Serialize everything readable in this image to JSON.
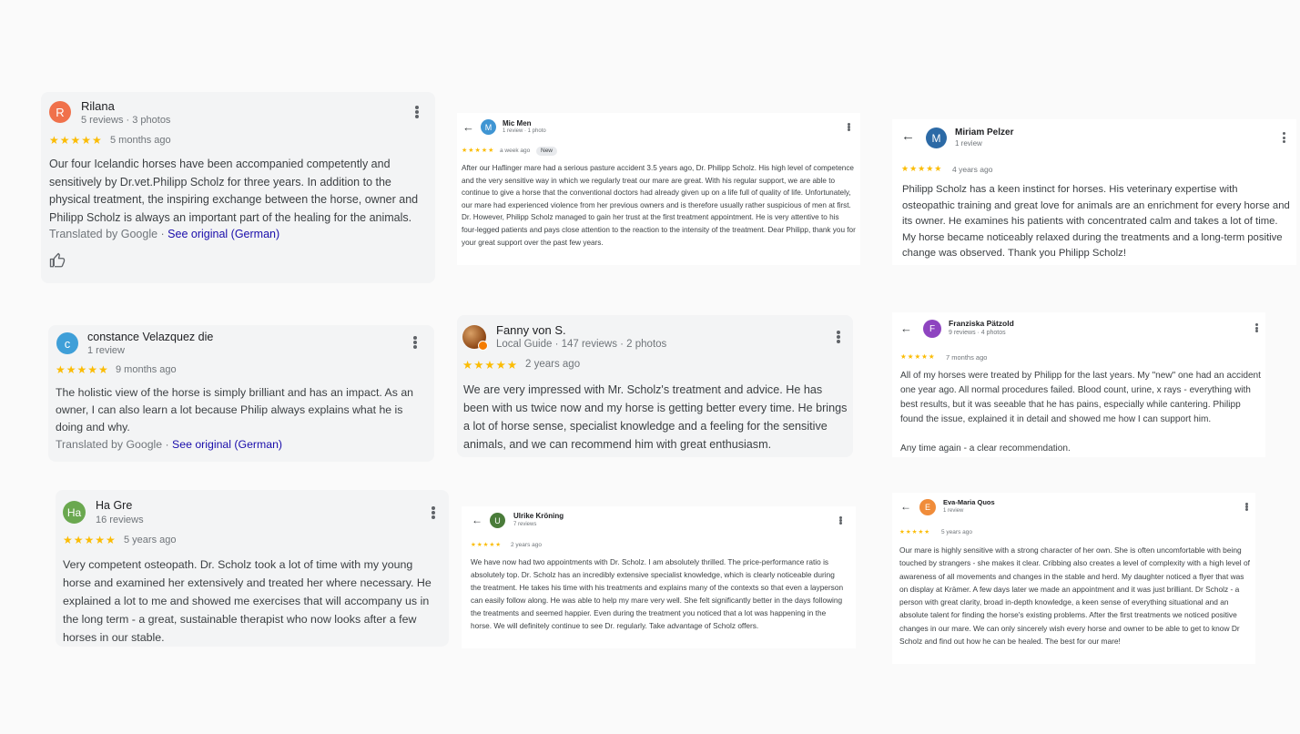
{
  "reviews": [
    {
      "avatar_letter": "R",
      "avatar_color": "#f0714b",
      "name": "Rilana",
      "meta": "5 reviews · 3 photos",
      "stars": "★★★★★",
      "time": "5 months ago",
      "text": "Our four Icelandic horses have been accompanied competently and sensitively by Dr.vet.Philipp Scholz for three years. In addition to the physical treatment, the inspiring exchange between the horse, owner and Philipp Scholz is always an important part of the healing for the animals.",
      "translated_prefix": "Translated by Google · ",
      "see_original": "See original (German)"
    },
    {
      "avatar_letter": "M",
      "avatar_color": "#3f95d3",
      "name": "Mic Men",
      "meta": "1 review · 1 photo",
      "stars": "★★★★★",
      "time": "a week ago",
      "badge": "New",
      "text": "After our Haflinger mare had a serious pasture accident 3.5 years ago, Dr. Philipp Scholz. His high level of competence and the very sensitive way in which we regularly treat our mare are great. With his regular support, we are able to continue to give a horse that the conventional doctors had already given up on a life full of quality of life. Unfortunately, our mare had experienced violence from her previous owners and is therefore usually rather suspicious of men at first. Dr. However, Philipp Scholz managed to gain her trust at the first treatment appointment. He is very attentive to his four-legged patients and pays close attention to the reaction to the intensity of the treatment. Dear Philipp, thank you for your great support over the past few years."
    },
    {
      "avatar_letter": "M",
      "avatar_color": "#2c6aa6",
      "name": "Miriam Pelzer",
      "meta": "1 review",
      "stars": "★★★★★",
      "time": "4 years ago",
      "text": "Philipp Scholz has a keen instinct for horses. His veterinary expertise with osteopathic training and great love for animals are an enrichment for every horse and its owner. He examines his patients with concentrated calm and takes a lot of time. My horse became noticeably relaxed during the treatments and a long-term positive change was observed. Thank you Philipp Scholz!"
    },
    {
      "avatar_letter": "c",
      "avatar_color": "#3f9fd8",
      "name": "constance Velazquez die",
      "meta": "1 review",
      "stars": "★★★★★",
      "time": "9 months ago",
      "text": "The holistic view of the horse is simply brilliant and has an impact. As an owner, I can also learn a lot because Philip always explains what he is doing and why.",
      "translated_prefix": "Translated by Google · ",
      "see_original": "See original (German)"
    },
    {
      "avatar_color": "#a0522d",
      "name": "Fanny von S.",
      "meta": "Local Guide · 147 reviews · 2 photos",
      "stars": "★★★★★",
      "time": "2 years ago",
      "text": "We are very impressed with Mr. Scholz's treatment and advice. He has been with us twice now and my horse is getting better every time. He brings a lot of horse sense, specialist knowledge and a feeling for the sensitive animals, and we can recommend him with great enthusiasm."
    },
    {
      "avatar_letter": "F",
      "avatar_color": "#8e44c0",
      "name": "Franziska Pätzold",
      "meta": "9 reviews · 4 photos",
      "stars": "★★★★★",
      "time": "7 months ago",
      "text": "All of my horses were treated by Philipp for the last years. My \"new\" one had an accident one year ago. All normal procedures failed. Blood count, urine, x rays - everything with best results, but it was seeable that he has pains, especially while cantering. Philipp found the issue, explained it in detail and showed me how I can support him.",
      "text2": "Any time again - a clear recommendation."
    },
    {
      "avatar_letter": "Ha",
      "avatar_color": "#6aa84f",
      "name": "Ha Gre",
      "meta": "16 reviews",
      "stars": "★★★★★",
      "time": "5 years ago",
      "text": "Very competent osteopath. Dr. Scholz took a lot of time with my young horse and examined her extensively and treated her where necessary. He explained a lot to me and showed me exercises that will accompany us in the long term - a great, sustainable therapist who now looks after a few horses in our stable."
    },
    {
      "avatar_letter": "U",
      "avatar_color": "#4a7c3a",
      "name": "Ulrike Kröning",
      "meta": "7 reviews",
      "stars": "★★★★★",
      "time": "2 years ago",
      "text": "We have now had two appointments with Dr. Scholz. I am absolutely thrilled. The price-performance ratio is absolutely top. Dr. Scholz has an incredibly extensive specialist knowledge, which is clearly noticeable during the treatment. He takes his time with his treatments and explains many of the contexts so that even a layperson can easily follow along. He was able to help my mare very well. She felt significantly better in the days following the treatments and seemed happier. Even during the treatment you noticed that a lot was happening in the horse. We will definitely continue to see Dr. regularly. Take advantage of Scholz offers."
    },
    {
      "avatar_letter": "E",
      "avatar_color": "#f08c3a",
      "name": "Eva-Maria Quos",
      "meta": "1 review",
      "stars": "★★★★★",
      "time": "5 years ago",
      "text": "Our mare is highly sensitive with a strong character of her own. She is often uncomfortable with being touched by strangers - she makes it clear. Cribbing also creates a level of complexity with a high level of awareness of all movements and changes in the stable and herd. My daughter noticed a flyer that was on display at Krämer. A few days later we made an appointment and it was just brilliant. Dr Scholz - a person with great clarity, broad in-depth knowledge, a keen sense of everything situational and an absolute talent for finding the horse's existing problems. After the first treatments we noticed positive changes in our mare. We can only sincerely wish every horse and owner to be able to get to know Dr Scholz and find out how he can be healed. The best for our mare!"
    }
  ]
}
